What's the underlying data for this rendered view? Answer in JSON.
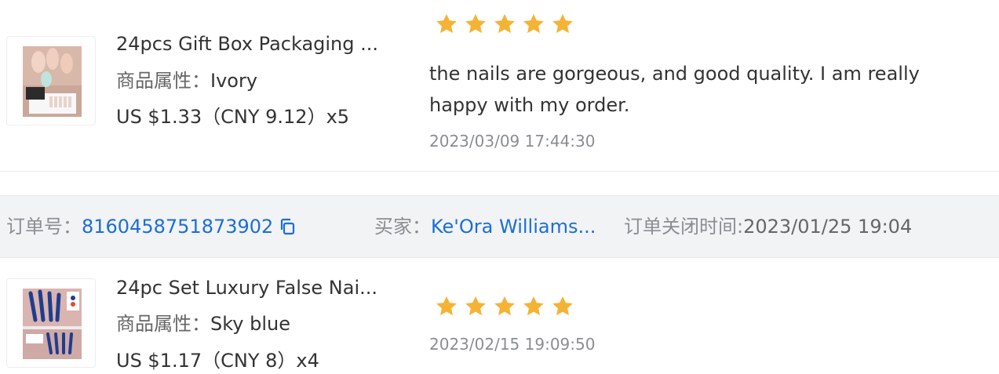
{
  "reviews": [
    {
      "product_title": "24pcs Gift Box Packaging ...",
      "attr_label": "商品属性：",
      "attr_value": "Ivory",
      "price": "US $1.33（CNY  9.12）x5",
      "rating": 5,
      "review_text": "the nails are gorgeous, and good quality. I am really happy with my order.",
      "date": "2023/03/09 17:44:30"
    },
    {
      "product_title": "24pc Set Luxury False Nai...",
      "attr_label": "商品属性：",
      "attr_value": "Sky blue",
      "price": "US $1.17（CNY  8）x4",
      "rating": 5,
      "date": "2023/02/15 19:09:50"
    }
  ],
  "order_bar": {
    "order_label": "订单号：",
    "order_number": "8160458751873902",
    "buyer_label": "买家：",
    "buyer_name": "Ke'Ora Williams...",
    "closed_label": "订单关闭时间:",
    "closed_time": "2023/01/25 19:04"
  },
  "icons": {
    "star": "star-icon",
    "copy": "copy-icon"
  },
  "colors": {
    "star": "#f5b335",
    "link": "#1a6fd6",
    "bar_bg": "#f2f3f5",
    "muted": "#8a8d91"
  }
}
